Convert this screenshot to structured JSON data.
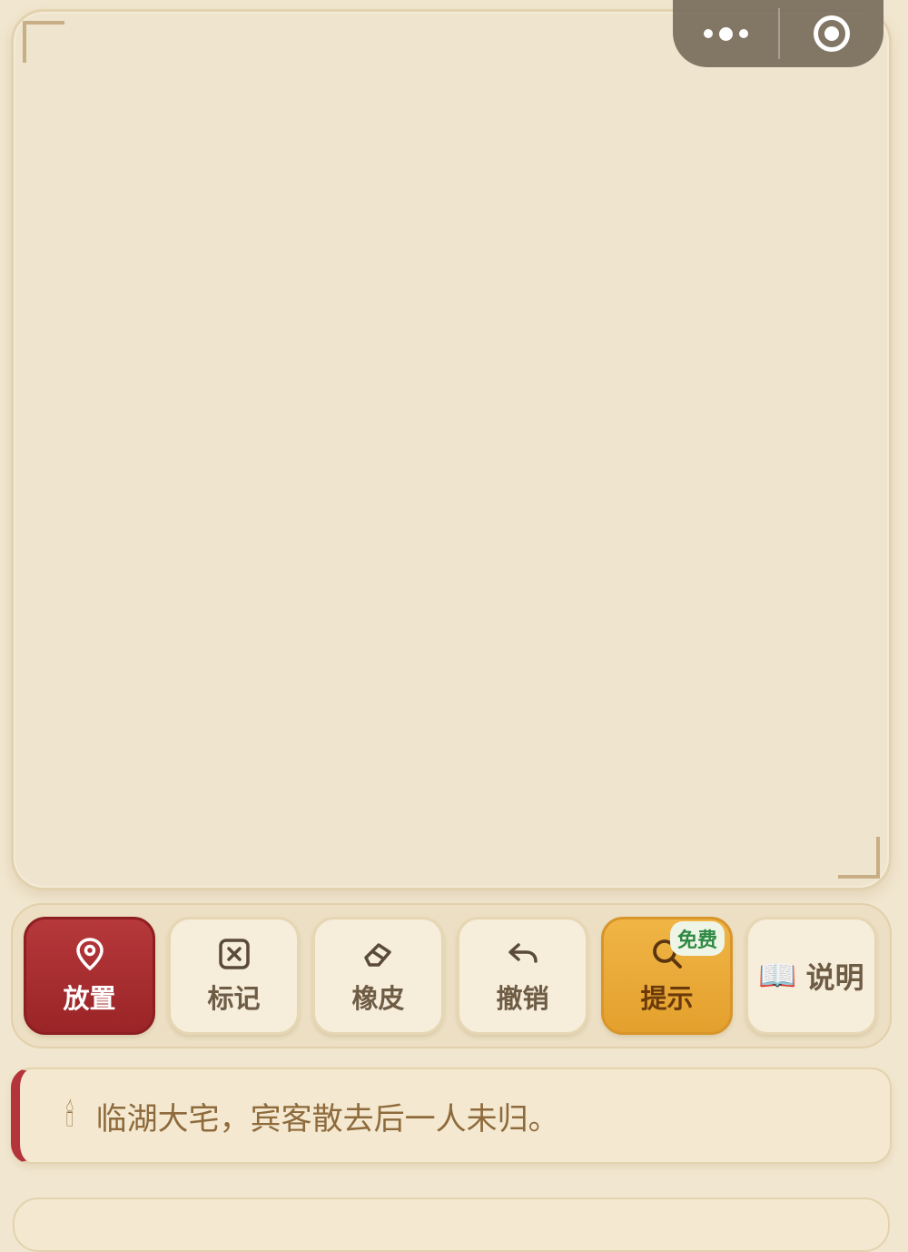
{
  "toolbar": {
    "place_label": "放置",
    "mark_label": "标记",
    "eraser_label": "橡皮",
    "undo_label": "撤销",
    "hint_label": "提示",
    "hint_badge": "免费",
    "help_label": "说明",
    "help_icon": "📖"
  },
  "story": {
    "icon": "🕯",
    "text": "临湖大宅，宾客散去后一人未归。"
  },
  "colors": {
    "accent_red": "#9a2427",
    "hint_orange": "#e4a02d",
    "background": "#f1e6cf"
  },
  "icons": {
    "place": "map-pin-icon",
    "mark": "x-square-icon",
    "eraser": "eraser-icon",
    "undo": "undo-arrow-icon",
    "hint": "search-icon",
    "help": "book-icon",
    "story": "candle-icon",
    "capsule_more": "more-dots-icon",
    "capsule_close": "target-close-icon"
  }
}
